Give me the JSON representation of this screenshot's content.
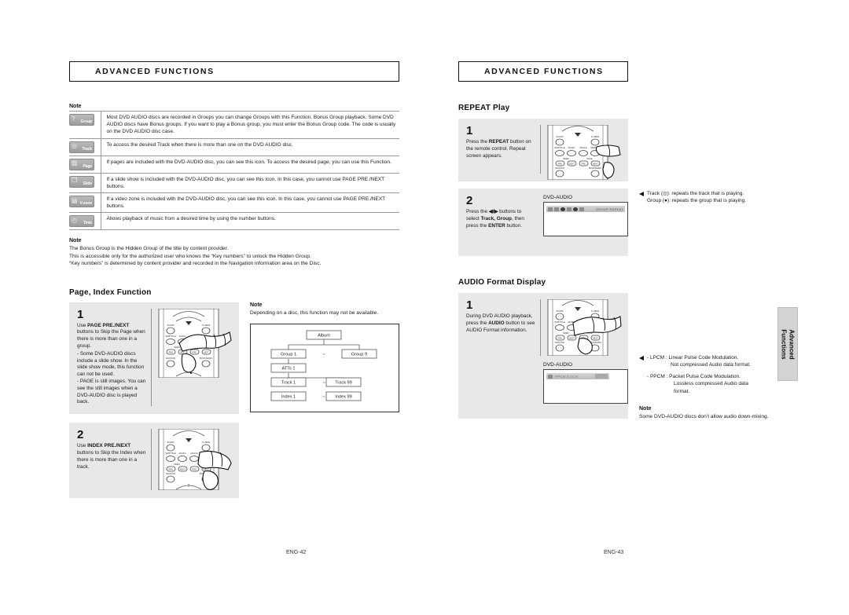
{
  "left_page": {
    "header": "ADVANCED FUNCTIONS",
    "note_label": "Note",
    "icon_rows": [
      {
        "icon": "group-icon",
        "icon_label": "Group",
        "icon_glyph": "?",
        "text": "Most DVD AUDIO discs are recorded in Groups you can change Groups with this Function. Bonus Group playback. Some DVD AUDIO discs have Bonus groups. If you want to play a Bonus group, you must enter the Bonus Group code. The code is usually on the DVD AUDIO disc case."
      },
      {
        "icon": "track-icon",
        "icon_label": "Track",
        "icon_glyph": "◎",
        "text": "To access the desired Track when there is more than one on the DVD AUDIO disc."
      },
      {
        "icon": "page-icon",
        "icon_label": "Page",
        "icon_glyph": "▧",
        "text": "If pages are included with the DVD-AUDIO disc, you can see this icon. To access the desired page, you can use this Function."
      },
      {
        "icon": "slide-icon",
        "icon_label": "Slide",
        "icon_glyph": "❐",
        "text": "If a slide show is included with the DVD-AUDIO disc, you can see this icon. In this case, you cannot use PAGE PRE./NEXT buttons."
      },
      {
        "icon": "vzone-icon",
        "icon_label": "V-zone",
        "icon_glyph": "▤",
        "text": "If a video zone is included with the DVD-AUDIO disc, you can see this icon. In this case, you cannot use PAGE PRE./NEXT buttons."
      },
      {
        "icon": "time-icon",
        "icon_label": "Time",
        "icon_glyph": "◴",
        "text": "Allows playback of music from a desired time by using the number buttons."
      }
    ],
    "bonus_note": {
      "label": "Note",
      "line1": "The Bonus Group is the Hidden Group of the title by content provider.",
      "line2": "This is accessible only for the authorized user who knows the “Key numbers” to unlock the Hidden Group.",
      "line3": "“Key numbers” is determined by content provider and recorded in the Navigation information area on the Disc."
    },
    "page_index_section": {
      "title": "Page, Index Function",
      "step1": {
        "number": "1",
        "line1_pre": "Use ",
        "line1_bold": "PAGE PRE./NEXT",
        "line1_post": " buttons to Skip the Page when there is more than one in a group.",
        "bullet1": "- Some DVD-AUDIO discs include a slide show. In the slide show mode, this function can not be used.",
        "bullet2": "- PAGE is still images. You can see the still images when a DVD-AUDIO disc is played back."
      },
      "step2": {
        "number": "2",
        "line1_pre": "Use ",
        "line1_bold": "INDEX PRE./NEXT",
        "line1_post": " buttons to Skip the Index when there is more than one in a track."
      },
      "side_note": {
        "label": "Note",
        "text": "Depending on a disc, this function may not be available."
      },
      "tree": {
        "album": "Album",
        "group_first": "Group 1",
        "group_last": "Group 9",
        "atts": "ATTs 1",
        "track_first": "Track 1",
        "track_last": "Track 99",
        "index_first": "Index 1",
        "index_last": "Index 99",
        "tilde": "~"
      }
    },
    "footer": "ENG-42"
  },
  "right_page": {
    "header": "ADVANCED FUNCTIONS",
    "repeat_section": {
      "title": "REPEAT Play",
      "step1": {
        "number": "1",
        "pre": "Press the ",
        "bold": "REPEAT",
        "post": " button on the remote control. Repeat screen appears."
      },
      "step2": {
        "number": "2",
        "pre": "Press the ",
        "bold1": "◀/▶",
        "mid1": " buttons to select ",
        "bold2": "Track, Group",
        "mid2": ", then press the ",
        "bold3": "ENTER",
        "post": " button."
      },
      "osd_label": "DVD-AUDIO",
      "callout_line1": "Track (◎): repeats the track that is playing.",
      "callout_line2": "Group (●): repeats the group that is playing."
    },
    "audio_format_section": {
      "title": "AUDIO Format Display",
      "step1": {
        "number": "1",
        "pre": "During DVD AUDIO playback, press the ",
        "bold": "AUDIO",
        "post": " button to see AUDIO Format information."
      },
      "osd_label": "DVD-AUDIO",
      "osd_text": "PPCM 5.1CH",
      "lpcm_line1": "- LPCM : Linear Pulse Code Modulation.",
      "lpcm_line2": "Not compressed Audio data format.",
      "ppcm_line1": "- PPCM : Packet Pulse Code Modulation.",
      "ppcm_line2": "Lossless compressed Audio data",
      "ppcm_line3": "format.",
      "note_label": "Note",
      "note_text": "Some DVD-AUDIO discs don’t allow audio down-mixing."
    },
    "footer": "ENG-43"
  },
  "side_tab": {
    "line1": "Advanced",
    "line2": "Functions"
  }
}
